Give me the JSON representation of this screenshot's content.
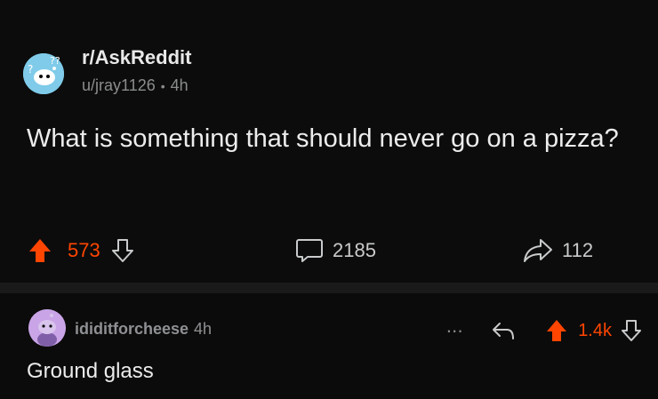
{
  "post": {
    "subreddit": "r/AskReddit",
    "author": "u/jray1126",
    "separator": "•",
    "age": "4h",
    "title": "What is something that should never go on a pizza?",
    "upvotes": "573",
    "comments": "2185",
    "shares": "112"
  },
  "comment": {
    "username": "ididitforcheese",
    "age": "4h",
    "body": "Ground glass",
    "more": "···",
    "votes": "1.4k"
  },
  "colors": {
    "upvote": "#ff4500",
    "background": "#0b0b0b",
    "subreddit_avatar": "#7fcbe9",
    "user_avatar": "#c9a4e6"
  }
}
